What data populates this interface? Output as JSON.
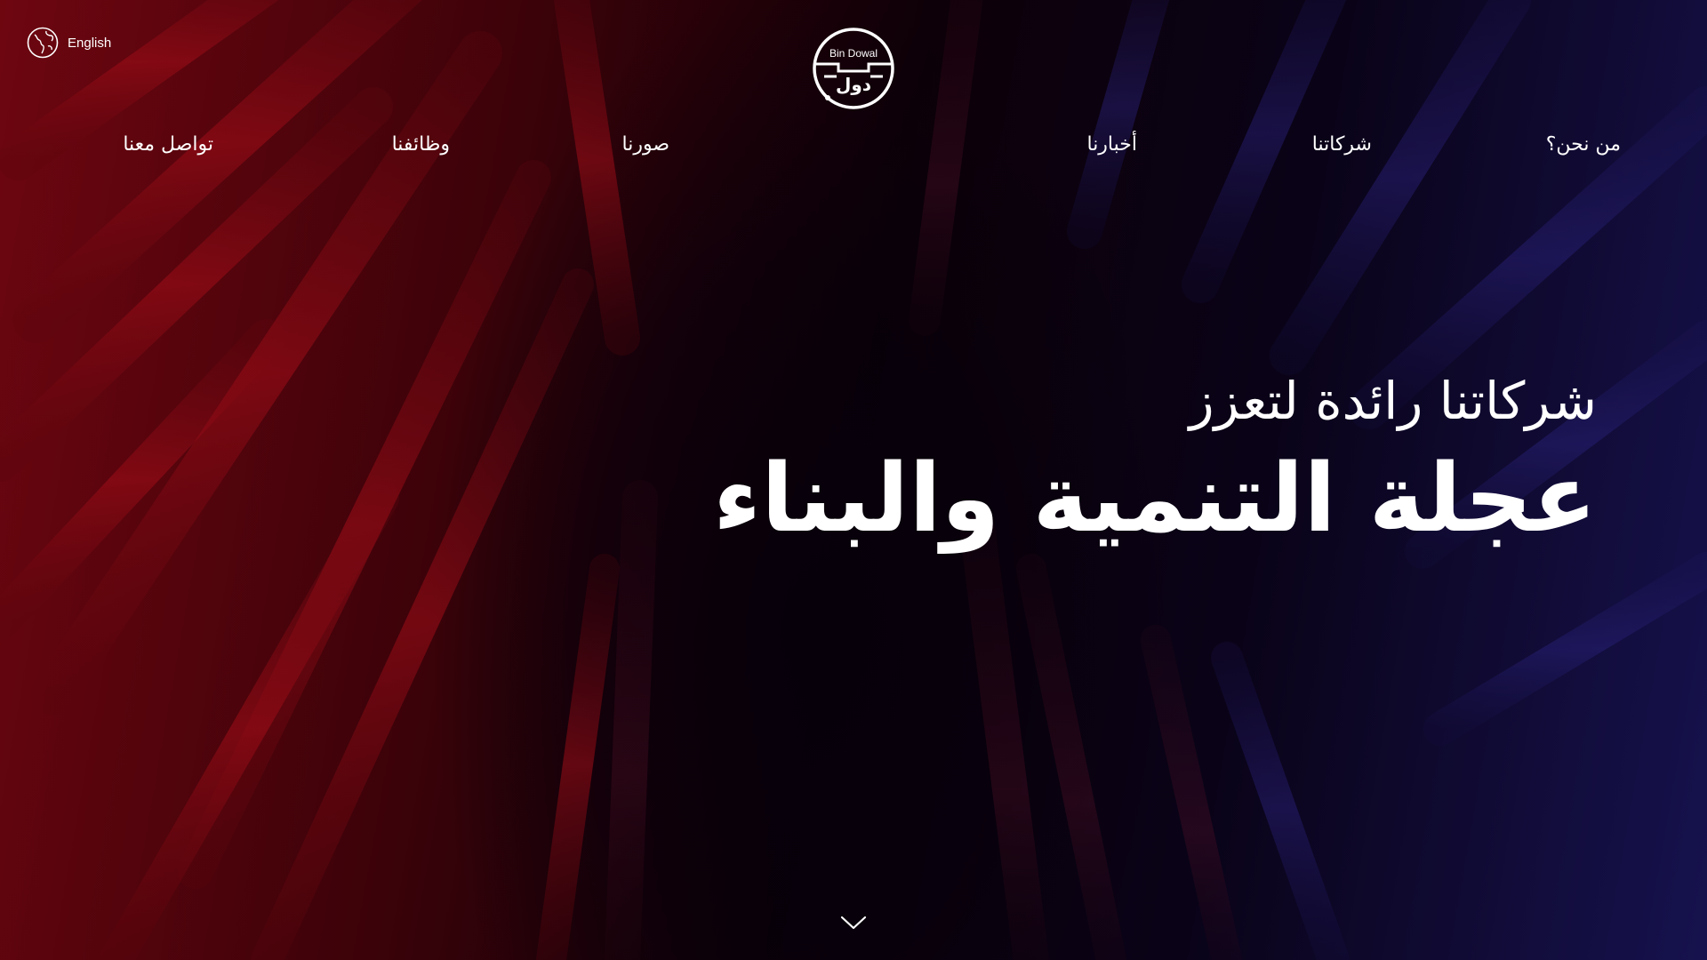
{
  "language_switch": {
    "label": "English",
    "icon": "globe-icon"
  },
  "logo": {
    "latin_text": "Bin Dowal",
    "arabic_text": "دول"
  },
  "nav": {
    "about": "من نحن؟",
    "companies": "شركاتنا",
    "news": "أخبارنا",
    "gallery": "صورنا",
    "careers": "وظائفنا",
    "contact": "تواصل معنا"
  },
  "hero": {
    "line1": "شركاتنا رائدة لتعزز",
    "line2": "عجلة التنمية والبناء"
  },
  "scroll": {
    "icon": "chevron-down-icon"
  },
  "colors": {
    "left_glow": "#8a0a14",
    "right_glow": "#1c1760",
    "text": "#ffffff"
  }
}
